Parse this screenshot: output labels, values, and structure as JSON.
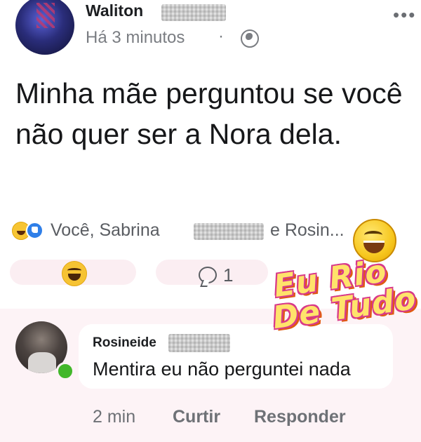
{
  "post": {
    "author_name": "Waliton",
    "timestamp": "Há 3 minutos",
    "separator": "·",
    "text": "Minha mãe perguntou  se você não quer ser a Nora dela."
  },
  "reactions": {
    "icons": [
      "haha-icon",
      "like-icon"
    ],
    "names_before": "Você, Sabrina",
    "names_after": "e Rosin..."
  },
  "actions": {
    "comment_count": "1"
  },
  "watermark": {
    "line1": "Eu Rio",
    "line2": "De Tudo"
  },
  "comment": {
    "author_name": "Rosineide",
    "text": "Mentira eu não perguntei nada",
    "time": "2 min",
    "like_label": "Curtir",
    "reply_label": "Responder",
    "online_color": "#42b72a"
  }
}
